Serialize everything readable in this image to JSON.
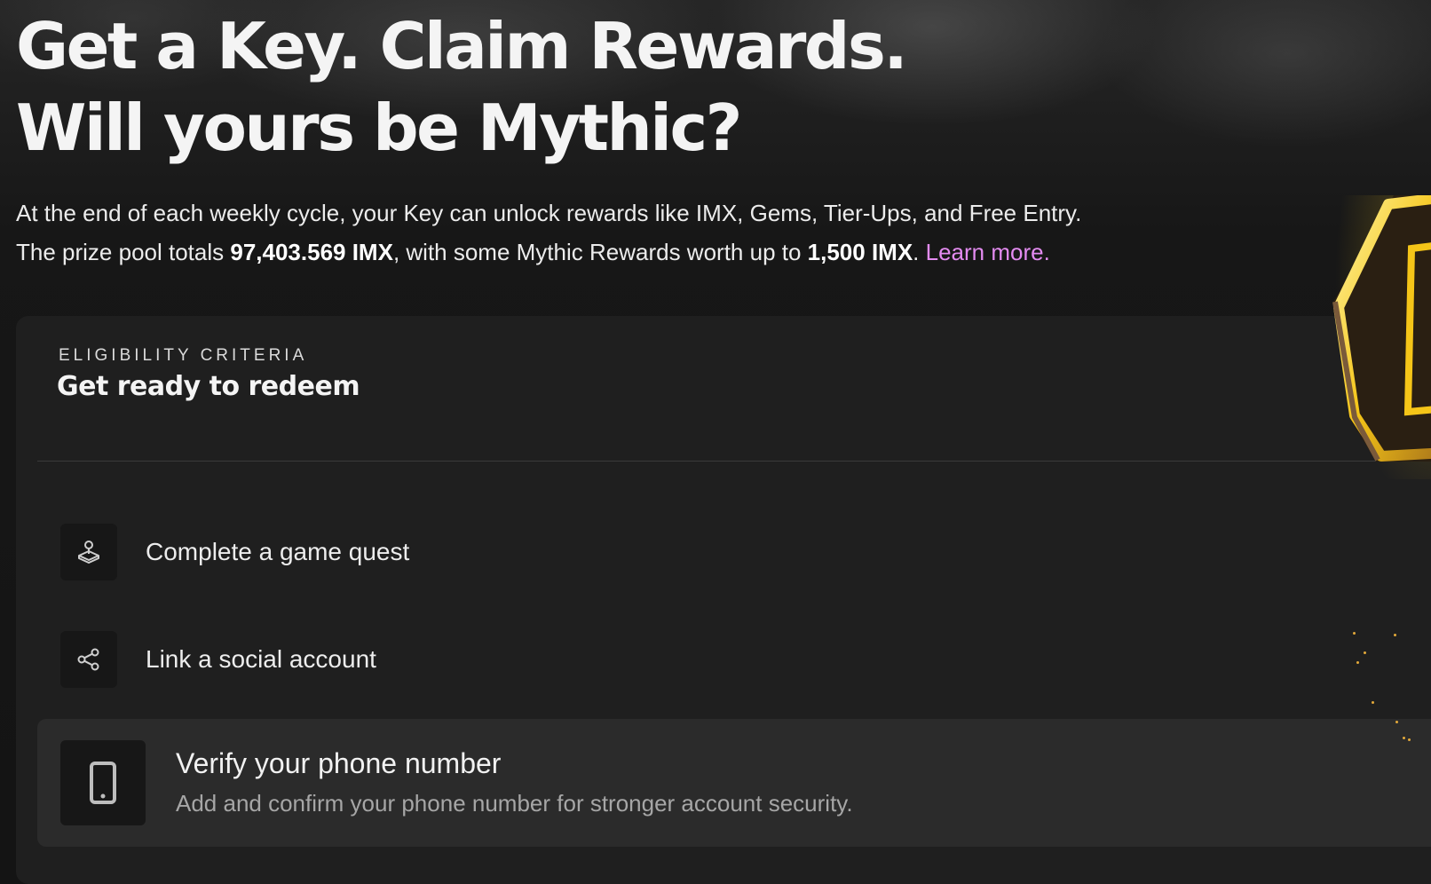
{
  "hero": {
    "title_line1": "Get a Key. Claim Rewards.",
    "title_line2": "Will yours be Mythic?",
    "desc_line1": "At the end of each weekly cycle, your Key can unlock rewards like IMX, Gems, Tier-Ups, and Free Entry.",
    "desc_line2_prefix": "The prize pool totals ",
    "prize_pool": "97,403.569 IMX",
    "desc_line2_middle": ", with some Mythic Rewards worth up to ",
    "mythic_max": "1,500 IMX",
    "desc_line2_suffix": ".",
    "learn_more": "Learn more."
  },
  "eligibility": {
    "eyebrow": "ELIGIBILITY CRITERIA",
    "title": "Get ready to redeem",
    "steps": [
      {
        "label": "Complete a game quest",
        "icon": "joystick-icon"
      },
      {
        "label": "Link a social account",
        "icon": "share-icon"
      },
      {
        "label": "Verify your phone number",
        "description": "Add and confirm your phone number for stronger account security.",
        "icon": "phone-icon"
      }
    ]
  },
  "colors": {
    "background": "#141414",
    "card": "#1f1f1f",
    "active_step": "#2b2b2b",
    "link": "#e38bf0",
    "key_gold": "#f5c518"
  }
}
